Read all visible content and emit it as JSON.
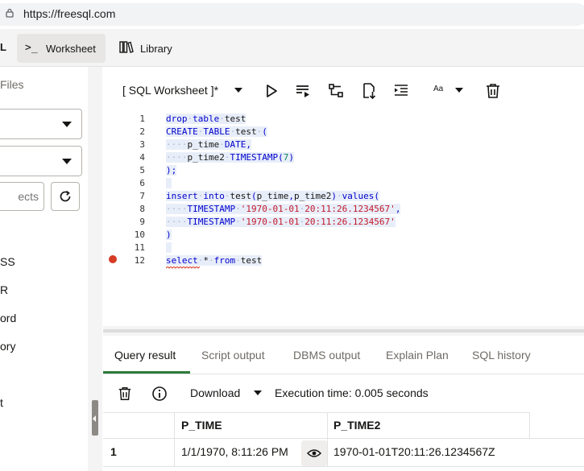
{
  "browser": {
    "url": "https://freesql.com"
  },
  "app_header": {
    "tabs": [
      {
        "label": "L"
      },
      {
        "label": "Worksheet",
        "icon": "terminal-icon",
        "active": true
      },
      {
        "label": "Library",
        "icon": "library-icon"
      }
    ]
  },
  "left_panel": {
    "files_label": "Files",
    "search_placeholder": "ects",
    "objects": [
      "SS",
      "R",
      "ord",
      "ory",
      "t"
    ]
  },
  "worksheet": {
    "title": "[ SQL Worksheet ]*",
    "font_label": "Aa",
    "toolbar_icons": [
      "run-icon",
      "run-script-icon",
      "explain-plan-icon",
      "download-icon",
      "format-icon",
      "font-icon",
      "delete-icon"
    ]
  },
  "editor": {
    "line_numbers": [
      "1",
      "2",
      "3",
      "4",
      "5",
      "6",
      "7",
      "8",
      "9",
      "10",
      "11",
      "12"
    ],
    "breakpoint_line": 12
  },
  "result_tabs": [
    {
      "label": "Query result",
      "active": true
    },
    {
      "label": "Script output"
    },
    {
      "label": "DBMS output"
    },
    {
      "label": "Explain Plan"
    },
    {
      "label": "SQL history"
    }
  ],
  "result_toolbar": {
    "download_label": "Download",
    "execution_time": "Execution time: 0.005 seconds"
  },
  "result_grid": {
    "columns": [
      "P_TIME",
      "P_TIME2"
    ],
    "rows": [
      {
        "num": "1",
        "p_time": "1/1/1970, 8:11:26 PM",
        "p_time2": "1970-01-01T20:11:26.1234567Z"
      }
    ]
  },
  "colors": {
    "keyword": "#0000cc",
    "string": "#c3192b",
    "selection": "#e8eef9",
    "accent_underline": "#2b7a3b",
    "breakpoint": "#d63b25"
  }
}
